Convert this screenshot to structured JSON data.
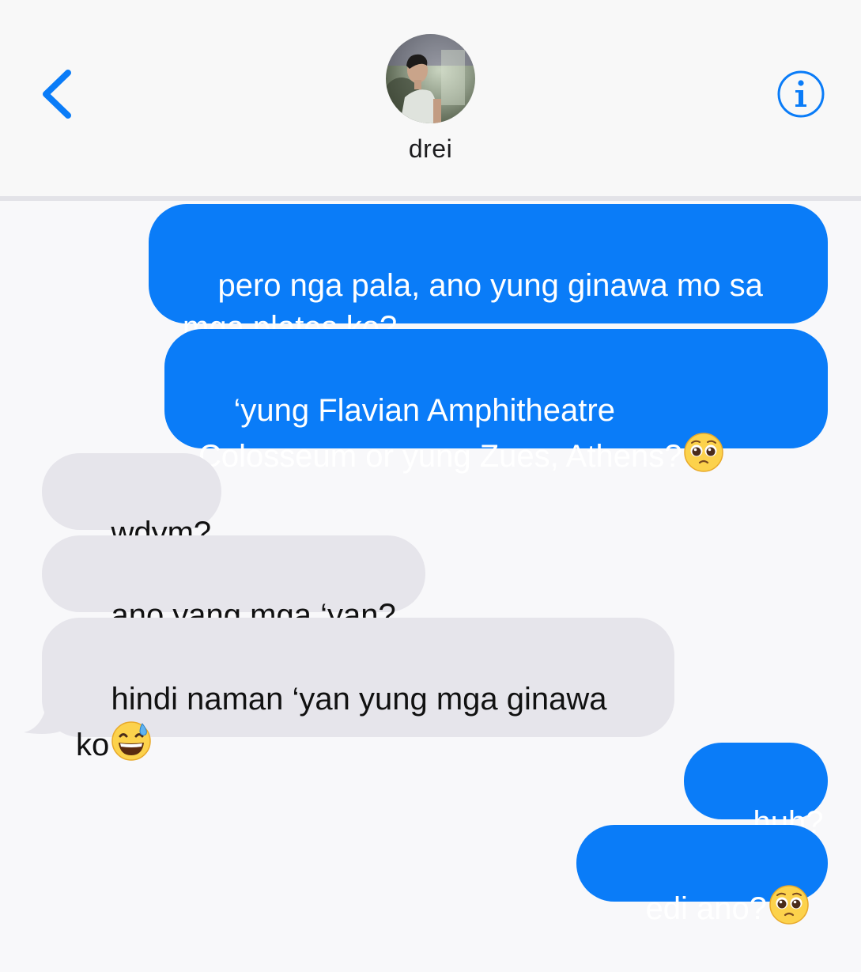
{
  "header": {
    "contact_name": "drei",
    "back_icon": "chevron-left-icon",
    "info_icon": "info-circle-icon",
    "accent_color": "#0a7cf8"
  },
  "messages": [
    {
      "direction": "sent",
      "text": "pero nga pala, ano yung ginawa mo sa\nmga plates ko?"
    },
    {
      "direction": "sent",
      "text": "‘yung Flavian Amphitheatre\nColosseum or yung Zues, Athens?",
      "emoji": "pleading-face-emoji"
    },
    {
      "direction": "received",
      "text": "wdym?"
    },
    {
      "direction": "received",
      "text": "ano yang mga ‘yan?"
    },
    {
      "direction": "received",
      "text": "hindi naman ‘yan yung mga ginawa\nko",
      "emoji": "grinning-sweat-face-emoji"
    },
    {
      "direction": "sent",
      "text": "huh?"
    },
    {
      "direction": "sent",
      "text": "edi ano?",
      "emoji": "pleading-face-emoji"
    }
  ],
  "colors": {
    "sent_bubble": "#0a7cf8",
    "received_bubble": "#e6e5eb"
  }
}
